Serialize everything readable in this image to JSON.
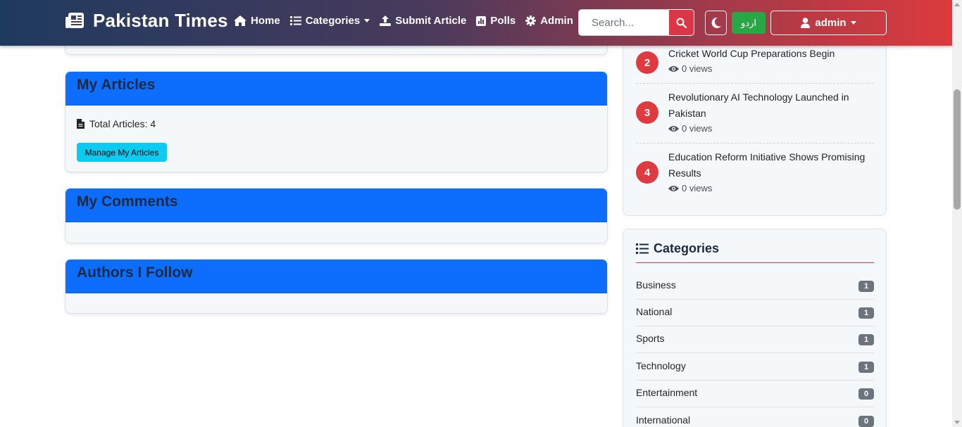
{
  "navbar": {
    "brand": "Pakistan Times",
    "items": [
      {
        "label": "Home",
        "icon": "home-icon"
      },
      {
        "label": "Categories",
        "icon": "list-icon"
      },
      {
        "label": "Submit Article",
        "icon": "upload-icon"
      },
      {
        "label": "Polls",
        "icon": "poll-icon"
      },
      {
        "label": "Admin",
        "icon": "gear-icon"
      }
    ],
    "search_placeholder": "Search...",
    "urdu_label": "اردو",
    "user_label": "admin"
  },
  "my_articles": {
    "title": "My Articles",
    "total": "Total Articles: 4",
    "manage_label": "Manage My Articles"
  },
  "my_comments": {
    "title": "My Comments"
  },
  "authors_follow": {
    "title": "Authors I Follow"
  },
  "popular": [
    {
      "rank": "2",
      "title": "Cricket World Cup Preparations Begin",
      "views": "0 views"
    },
    {
      "rank": "3",
      "title": "Revolutionary AI Technology Launched in Pakistan",
      "views": "0 views"
    },
    {
      "rank": "4",
      "title": "Education Reform Initiative Shows Promising Results",
      "views": "0 views"
    }
  ],
  "categories": {
    "title": "Categories",
    "items": [
      {
        "name": "Business",
        "count": "1"
      },
      {
        "name": "National",
        "count": "1"
      },
      {
        "name": "Sports",
        "count": "1"
      },
      {
        "name": "Technology",
        "count": "1"
      },
      {
        "name": "Entertainment",
        "count": "0"
      },
      {
        "name": "International",
        "count": "0"
      }
    ]
  },
  "colors": {
    "accent_blue": "#0d6efd",
    "accent_red": "#dc3545",
    "urdu_green": "#28a745",
    "info_cyan": "#0dcaf0"
  }
}
